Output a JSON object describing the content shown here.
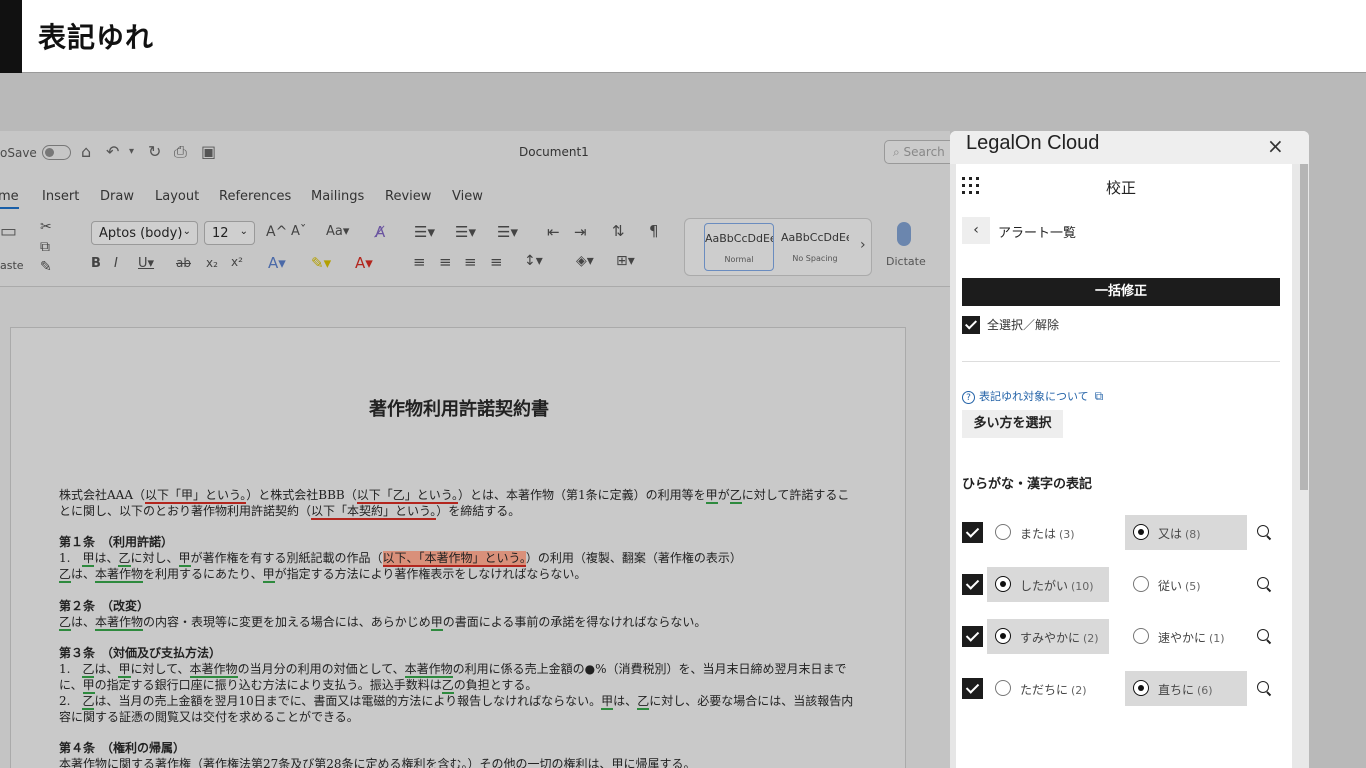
{
  "header": {
    "title": "表記ゆれ"
  },
  "word": {
    "titlebar": {
      "autosave": "oSave",
      "doc_name": "Document1",
      "search_placeholder": "Search"
    },
    "menus": [
      "me",
      "Insert",
      "Draw",
      "Layout",
      "References",
      "Mailings",
      "Review",
      "View"
    ],
    "ribbon": {
      "paste": "aste",
      "font_name": "Aptos (body)",
      "font_size": "12",
      "style_normal_sample": "AaBbCcDdEe",
      "style_normal_name": "Normal",
      "style_nospacing_sample": "AaBbCcDdEe",
      "style_nospacing_name": "No Spacing",
      "dictate": "Dictate"
    },
    "document": {
      "title": "著作物利用許諾契約書",
      "p1": {
        "a": "株式会社AAA（",
        "b": "以下「甲」という。",
        "c": "）と株式会社BBB（",
        "d": "以下「乙」という。",
        "e": "）とは、本著作物（第1条に定義）の利用等を",
        "f": "甲",
        "g": "が",
        "h": "乙",
        "i": "に対して許諾することに関し、以下のとおり著作物利用許諾契約（",
        "j": "以下「本契約」という。",
        "k": "）を締結する。"
      },
      "a1": {
        "heading": "第１条　（利用許諾）",
        "l1a": "1.　",
        "l1b": "甲",
        "l1c": "は、",
        "l1d": "乙",
        "l1e": "に対し、",
        "l1f": "甲",
        "l1g": "が著作権を有する別紙記載の作品（",
        "l1h": "以下、「本著作物」という。",
        "l1i": "）の利用（複製、翻案（著作権の表示）",
        "l2a": "乙",
        "l2b": "は、",
        "l2c": "本著作物",
        "l2d": "を利用するにあたり、",
        "l2e": "甲",
        "l2f": "が指定する方法により著作権表示をしなければならない。"
      },
      "a2": {
        "heading": "第２条　（改変）",
        "a": "乙",
        "b": "は、",
        "c": "本著作物",
        "d": "の内容・表現等に変更を加える場合には、あらかじめ",
        "e": "甲",
        "f": "の書面による事前の承諾を得なければならない。"
      },
      "a3": {
        "heading": "第３条　（対価及び支払方法）",
        "l1a": "1.　",
        "l1b": "乙",
        "l1c": "は、",
        "l1d": "甲",
        "l1e": "に対して、",
        "l1f": "本著作物",
        "l1g": "の当月分の利用の対価として、",
        "l1h": "本著作物",
        "l1i": "の利用に係る売上金額の●%（消費税別）を、当月末日締め翌月末日までに、",
        "l1j": "甲",
        "l1k": "の指定する銀行口座に振り込む方法により支払う。振込手数料は",
        "l1l": "乙",
        "l1m": "の負担とする。",
        "l2a": "2.　",
        "l2b": "乙",
        "l2c": "は、当月の売上金額を翌月10日までに、書面又は電磁的方法により報告しなければならない。",
        "l2d": "甲",
        "l2e": "は、",
        "l2f": "乙",
        "l2g": "に対し、必要な場合には、当該報告内容に関する証憑の閲覧又は交付を求めることができる。"
      },
      "a4": {
        "heading": "第４条　（権利の帰属）",
        "l1": "本著作物に関する著作権（著作権法第27条及び第28条に定める権利を含む。）その他の一切の権利は、甲に帰属する。"
      }
    }
  },
  "panel": {
    "brand": "LegalOn Cloud",
    "close_icon": "×",
    "section": "校正",
    "back_icon": "‹",
    "back_label": "アラート一覧",
    "bulk_fix": "一括修正",
    "select_all": "全選択／解除",
    "info_link": "表記ゆれ対象について",
    "major_button": "多い方を選択",
    "group_title": "ひらがな・漢字の表記",
    "rows": [
      {
        "left": {
          "label": "または",
          "count": "(3)",
          "selected": false
        },
        "right": {
          "label": "又は",
          "count": "(8)",
          "selected": true
        }
      },
      {
        "left": {
          "label": "したがい",
          "count": "(10)",
          "selected": true
        },
        "right": {
          "label": "従い",
          "count": "(5)",
          "selected": false
        }
      },
      {
        "left": {
          "label": "すみやかに",
          "count": "(2)",
          "selected": true
        },
        "right": {
          "label": "速やかに",
          "count": "(1)",
          "selected": false
        }
      },
      {
        "left": {
          "label": "ただちに",
          "count": "(2)",
          "selected": false
        },
        "right": {
          "label": "直ちに",
          "count": "(6)",
          "selected": true
        }
      }
    ]
  }
}
